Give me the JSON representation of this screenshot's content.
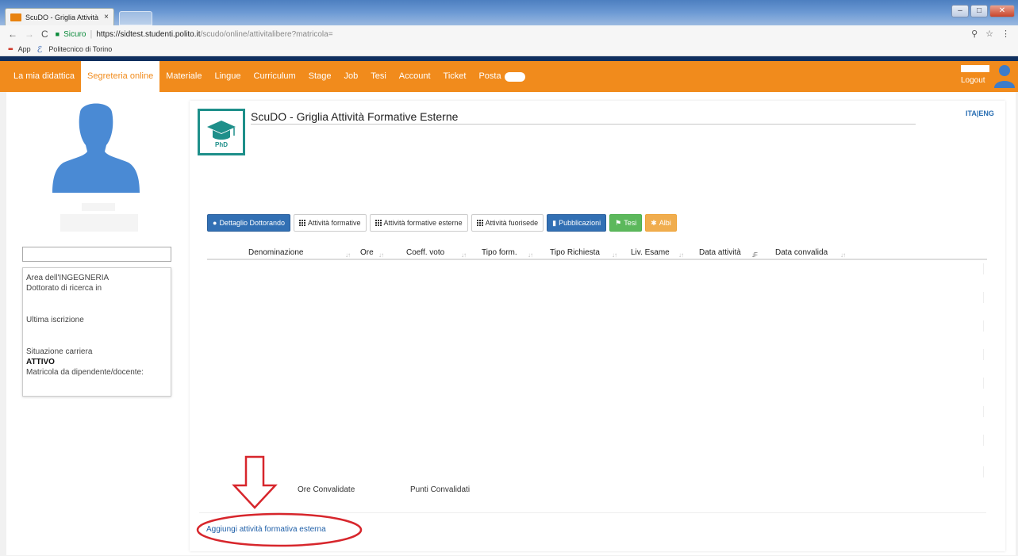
{
  "browser": {
    "tab_title": "ScuDO - Griglia Attività I",
    "tab_close": "×",
    "secure_label": "Sicuro",
    "url_host": "https://sidtest.studenti.polito.it",
    "url_path": "/scudo/online/attivitalibere?matricola=",
    "bookmarks": [
      "App",
      "Politecnico di Torino"
    ],
    "nav_back": "←",
    "nav_forward": "→",
    "reload": "C",
    "zoom_icon": "⚲",
    "star_icon": "☆",
    "menu_icon": "⋮",
    "min_icon": "–",
    "max_icon": "□",
    "close_icon": "✕"
  },
  "navbar": {
    "items": [
      "La mia didattica",
      "Segreteria online",
      "Materiale",
      "Lingue",
      "Curriculum",
      "Stage",
      "Job",
      "Tesi",
      "Account",
      "Ticket",
      "Posta"
    ],
    "active_index": 1,
    "logout": "Logout"
  },
  "profile": {
    "line1": "Area dell'INGEGNERIA",
    "line2": "Dottorato di ricerca in",
    "line3": "Ultima iscrizione",
    "line4": "Situazione carriera",
    "status": "ATTIVO",
    "line5": "Matricola da dipendente/docente:"
  },
  "main": {
    "title": "ScuDO - Griglia Attività Formative Esterne",
    "logo_text": "PhD",
    "lang": "ITA|ENG",
    "tabs": [
      {
        "label": "Dettaglio Dottorando",
        "style": "blue",
        "icon": "user-icon"
      },
      {
        "label": "Attività formative",
        "style": "white",
        "icon": "grid-icon"
      },
      {
        "label": "Attività formative esterne",
        "style": "white",
        "icon": "grid-icon"
      },
      {
        "label": "Attività fuorisede",
        "style": "white",
        "icon": "grid-icon"
      },
      {
        "label": "Pubblicazioni",
        "style": "blue",
        "icon": "book-icon"
      },
      {
        "label": "Tesi",
        "style": "green",
        "icon": "flag-icon"
      },
      {
        "label": "Albi",
        "style": "orange",
        "icon": "gear-icon"
      }
    ],
    "columns": [
      "Denominazione",
      "Ore",
      "Coeff. voto",
      "Tipo form.",
      "Tipo Richiesta",
      "Liv. Esame",
      "Data attività",
      "Data convalida"
    ],
    "ore_convalidate": "Ore Convalidate",
    "punti_convalidati": "Punti Convalidati",
    "add_link": "Aggiungi attività formativa esterna"
  },
  "colors": {
    "nav_orange": "#f18b1c",
    "band_navy": "#0f2f5f",
    "annotation_red": "#d7262c",
    "logo_teal": "#1e8f8a"
  }
}
